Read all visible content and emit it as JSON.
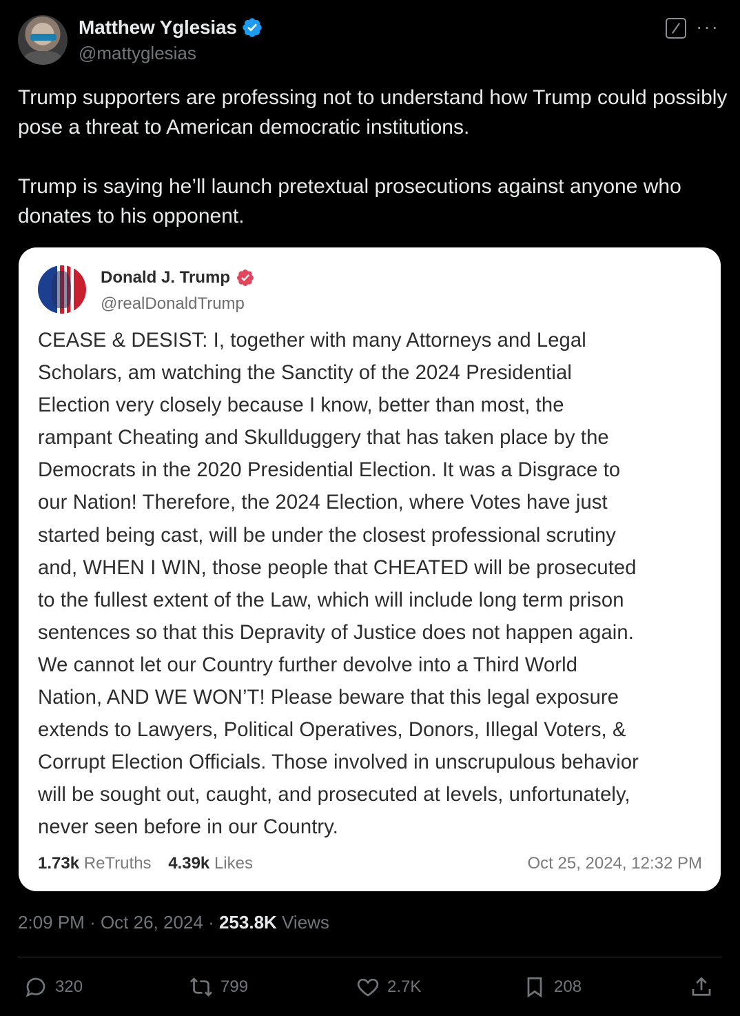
{
  "author": {
    "name": "Matthew Yglesias",
    "handle": "@mattyglesias"
  },
  "tweet": {
    "paragraphs": [
      "Trump supporters are professing not to understand how Trump could possibly pose a threat to American democratic institutions.",
      "Trump is saying he’ll launch pretextual prosecutions against anyone who donates to his opponent."
    ],
    "time": "2:09 PM",
    "date": "Oct 26, 2024",
    "views_count": "253.8K",
    "views_label": "Views"
  },
  "quoted": {
    "name": "Donald J. Trump",
    "handle": "@realDonaldTrump",
    "lines": [
      "CEASE & DESIST: I, together with many Attorneys and Legal",
      "Scholars, am watching the Sanctity of the 2024 Presidential",
      "Election very closely because I know, better than most, the",
      "rampant Cheating and Skullduggery that has taken place by the",
      "Democrats in the 2020 Presidential Election. It was a Disgrace to",
      "our Nation! Therefore, the 2024 Election, where Votes have just",
      "started being cast, will be under the closest professional scrutiny",
      "and, WHEN I WIN, those people that CHEATED will be prosecuted",
      "to the fullest extent of the Law, which will include long term prison",
      "sentences so that this Depravity of Justice does not happen again.",
      "We cannot let our Country further devolve into a Third World",
      "Nation, AND WE WON’T! Please beware that this legal exposure",
      "extends to Lawyers, Political Operatives, Donors, Illegal Voters, &",
      "Corrupt Election Officials. Those involved in unscrupulous behavior",
      "will be sought out, caught, and prosecuted at levels, unfortunately,",
      "never seen before in our Country."
    ],
    "retruths_count": "1.73k",
    "retruths_label": "ReTruths",
    "likes_count": "4.39k",
    "likes_label": "Likes",
    "timestamp": "Oct 25, 2024, 12:32 PM"
  },
  "actions": {
    "replies": "320",
    "reposts": "799",
    "likes": "2.7K",
    "bookmarks": "208"
  },
  "icons": [
    "verified-badge-icon",
    "grok-icon",
    "more-icon",
    "reply-icon",
    "repost-icon",
    "like-icon",
    "bookmark-icon",
    "share-icon"
  ],
  "colors": {
    "background": "#000000",
    "text": "#e7e9ea",
    "muted": "#71767b",
    "verified_blue": "#1d9bf0",
    "truth_badge": "#e0465e",
    "card_bg": "#ffffff"
  }
}
